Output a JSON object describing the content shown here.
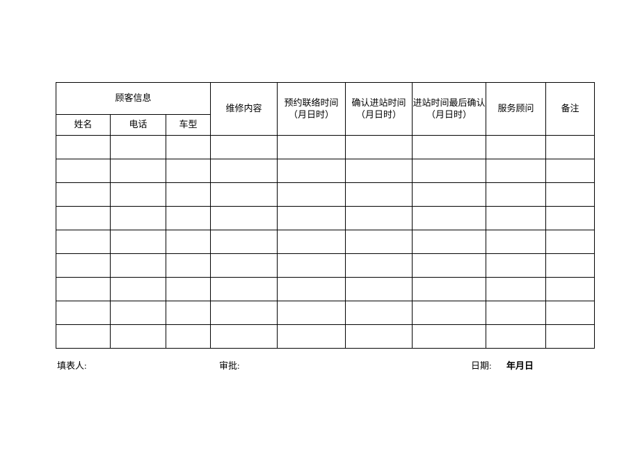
{
  "table": {
    "headers": {
      "customer_info_group": "顾客信息",
      "name": "姓名",
      "phone": "电话",
      "car_model": "车型",
      "repair_content": "维修内容",
      "reserve_contact_time": "预约联络时间（月日时）",
      "confirm_entry_time": "确认进站时间（月日时）",
      "entry_final_confirm": "进站时间最后确认（月日时）",
      "service_advisor": "服务顾问",
      "note": "备注"
    },
    "rows": [
      {
        "name": "",
        "phone": "",
        "model": "",
        "content": "",
        "reserve": "",
        "confirm": "",
        "final": "",
        "advisor": "",
        "note": ""
      },
      {
        "name": "",
        "phone": "",
        "model": "",
        "content": "",
        "reserve": "",
        "confirm": "",
        "final": "",
        "advisor": "",
        "note": ""
      },
      {
        "name": "",
        "phone": "",
        "model": "",
        "content": "",
        "reserve": "",
        "confirm": "",
        "final": "",
        "advisor": "",
        "note": ""
      },
      {
        "name": "",
        "phone": "",
        "model": "",
        "content": "",
        "reserve": "",
        "confirm": "",
        "final": "",
        "advisor": "",
        "note": ""
      },
      {
        "name": "",
        "phone": "",
        "model": "",
        "content": "",
        "reserve": "",
        "confirm": "",
        "final": "",
        "advisor": "",
        "note": ""
      },
      {
        "name": "",
        "phone": "",
        "model": "",
        "content": "",
        "reserve": "",
        "confirm": "",
        "final": "",
        "advisor": "",
        "note": ""
      },
      {
        "name": "",
        "phone": "",
        "model": "",
        "content": "",
        "reserve": "",
        "confirm": "",
        "final": "",
        "advisor": "",
        "note": ""
      },
      {
        "name": "",
        "phone": "",
        "model": "",
        "content": "",
        "reserve": "",
        "confirm": "",
        "final": "",
        "advisor": "",
        "note": ""
      },
      {
        "name": "",
        "phone": "",
        "model": "",
        "content": "",
        "reserve": "",
        "confirm": "",
        "final": "",
        "advisor": "",
        "note": ""
      }
    ]
  },
  "footer": {
    "preparer_label": "填表人:",
    "approve_label": "审批:",
    "date_label": "日期:",
    "date_value": "年月日"
  }
}
